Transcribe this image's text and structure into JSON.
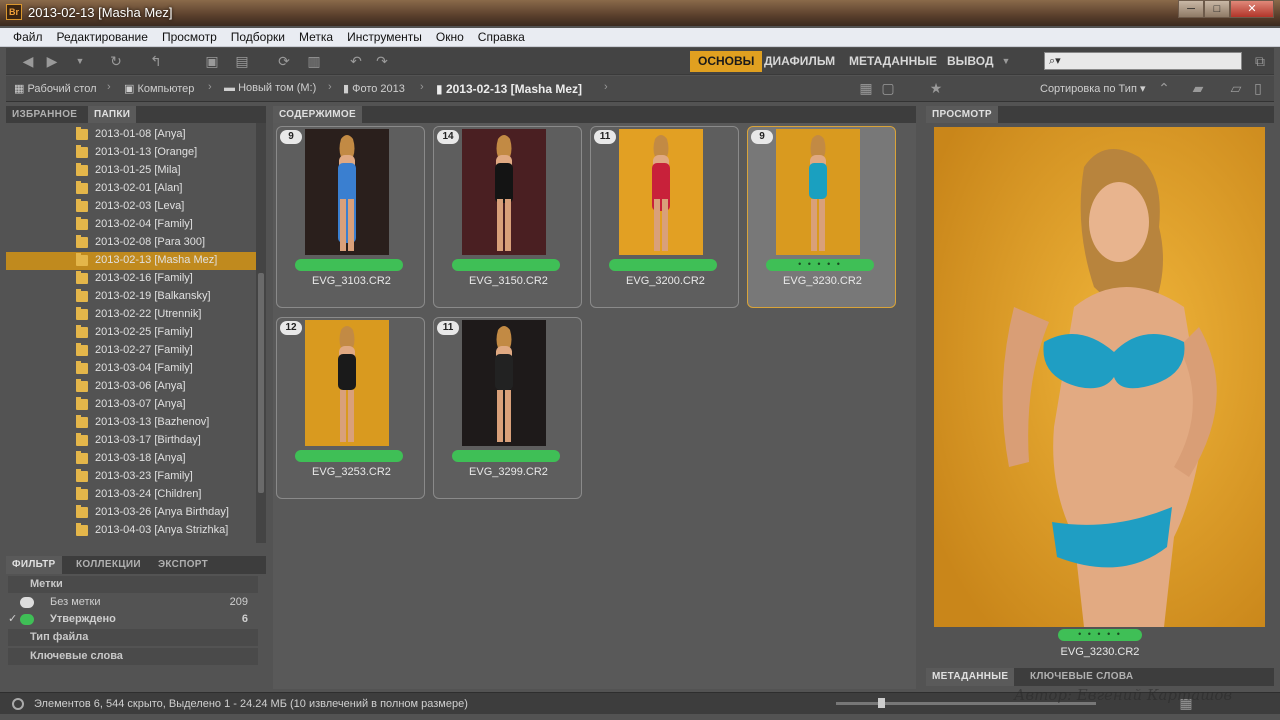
{
  "window": {
    "title": "2013-02-13 [Masha Mez]",
    "app_icon": "Br",
    "controls": [
      "─",
      "□",
      "✕"
    ]
  },
  "menu": [
    "Файл",
    "Редактирование",
    "Просмотр",
    "Подборки",
    "Метка",
    "Инструменты",
    "Окно",
    "Справка"
  ],
  "workspaces": [
    "ОСНОВЫ",
    "ДИАФИЛЬМ",
    "МЕТАДАННЫЕ",
    "ВЫВОД"
  ],
  "search": {
    "placeholder": "⌕▾"
  },
  "path": {
    "crumbs": [
      "Рабочий стол",
      "Компьютер",
      "Новый том (M:)",
      "Фото 2013",
      "2013-02-13 [Masha Mez]"
    ],
    "sort": "Сортировка по Тип ▾"
  },
  "left_tabs": [
    "ИЗБРАННОЕ",
    "ПАПКИ"
  ],
  "folders": [
    "2013-01-08 [Anya]",
    "2013-01-13 [Orange]",
    "2013-01-25 [Mila]",
    "2013-02-01 [Alan]",
    "2013-02-03 [Leva]",
    "2013-02-04 [Family]",
    "2013-02-08 [Para 300]",
    "2013-02-13 [Masha Mez]",
    "2013-02-16 [Family]",
    "2013-02-19 [Balkansky]",
    "2013-02-22 [Utrennik]",
    "2013-02-25 [Family]",
    "2013-02-27 [Family]",
    "2013-03-04 [Family]",
    "2013-03-06 [Anya]",
    "2013-03-07 [Anya]",
    "2013-03-13 [Bazhenov]",
    "2013-03-17 [Birthday]",
    "2013-03-18 [Anya]",
    "2013-03-23 [Family]",
    "2013-03-24 [Children]",
    "2013-03-26 [Anya Birthday]",
    "2013-04-03 [Anya Strizhka]"
  ],
  "filter_tabs": [
    "ФИЛЬТР",
    "КОЛЛЕКЦИИ",
    "ЭКСПОРТ"
  ],
  "filter": {
    "labels_header": "Метки",
    "no_label": "Без метки",
    "no_label_count": "209",
    "approved": "Утверждено",
    "approved_count": "6",
    "filetype_header": "Тип файла",
    "keywords_header": "Ключевые слова"
  },
  "content_tab": "СОДЕРЖИМОЕ",
  "thumbs": [
    {
      "badge": "9",
      "name": "EVG_3103.CR2",
      "label": "",
      "bg": "#2a1f1c",
      "dress": "#3a7fd0"
    },
    {
      "badge": "14",
      "name": "EVG_3150.CR2",
      "label": "",
      "bg": "#4a1f22",
      "dress": "#141414"
    },
    {
      "badge": "11",
      "name": "EVG_3200.CR2",
      "label": "",
      "bg": "#e2a023",
      "dress": "#c8213a"
    },
    {
      "badge": "9",
      "name": "EVG_3230.CR2",
      "label": "• • • • •",
      "bg": "#d99a1f",
      "dress": "#1aa0c0"
    },
    {
      "badge": "12",
      "name": "EVG_3253.CR2",
      "label": "",
      "bg": "#d99a1f",
      "dress": "#1a1a1a"
    },
    {
      "badge": "11",
      "name": "EVG_3299.CR2",
      "label": "",
      "bg": "#1e1a1a",
      "dress": "#222"
    }
  ],
  "preview_tab": "ПРОСМОТР",
  "preview": {
    "name": "EVG_3230.CR2",
    "label": "• • • • •"
  },
  "bottom_right_tabs": [
    "МЕТАДАННЫЕ",
    "КЛЮЧЕВЫЕ СЛОВА"
  ],
  "status": "Элементов 6, 544 скрыто, Выделено 1 - 24.24 МБ (10 извлечений в полном размере)",
  "watermark": "Автор: Евгений Карташов"
}
